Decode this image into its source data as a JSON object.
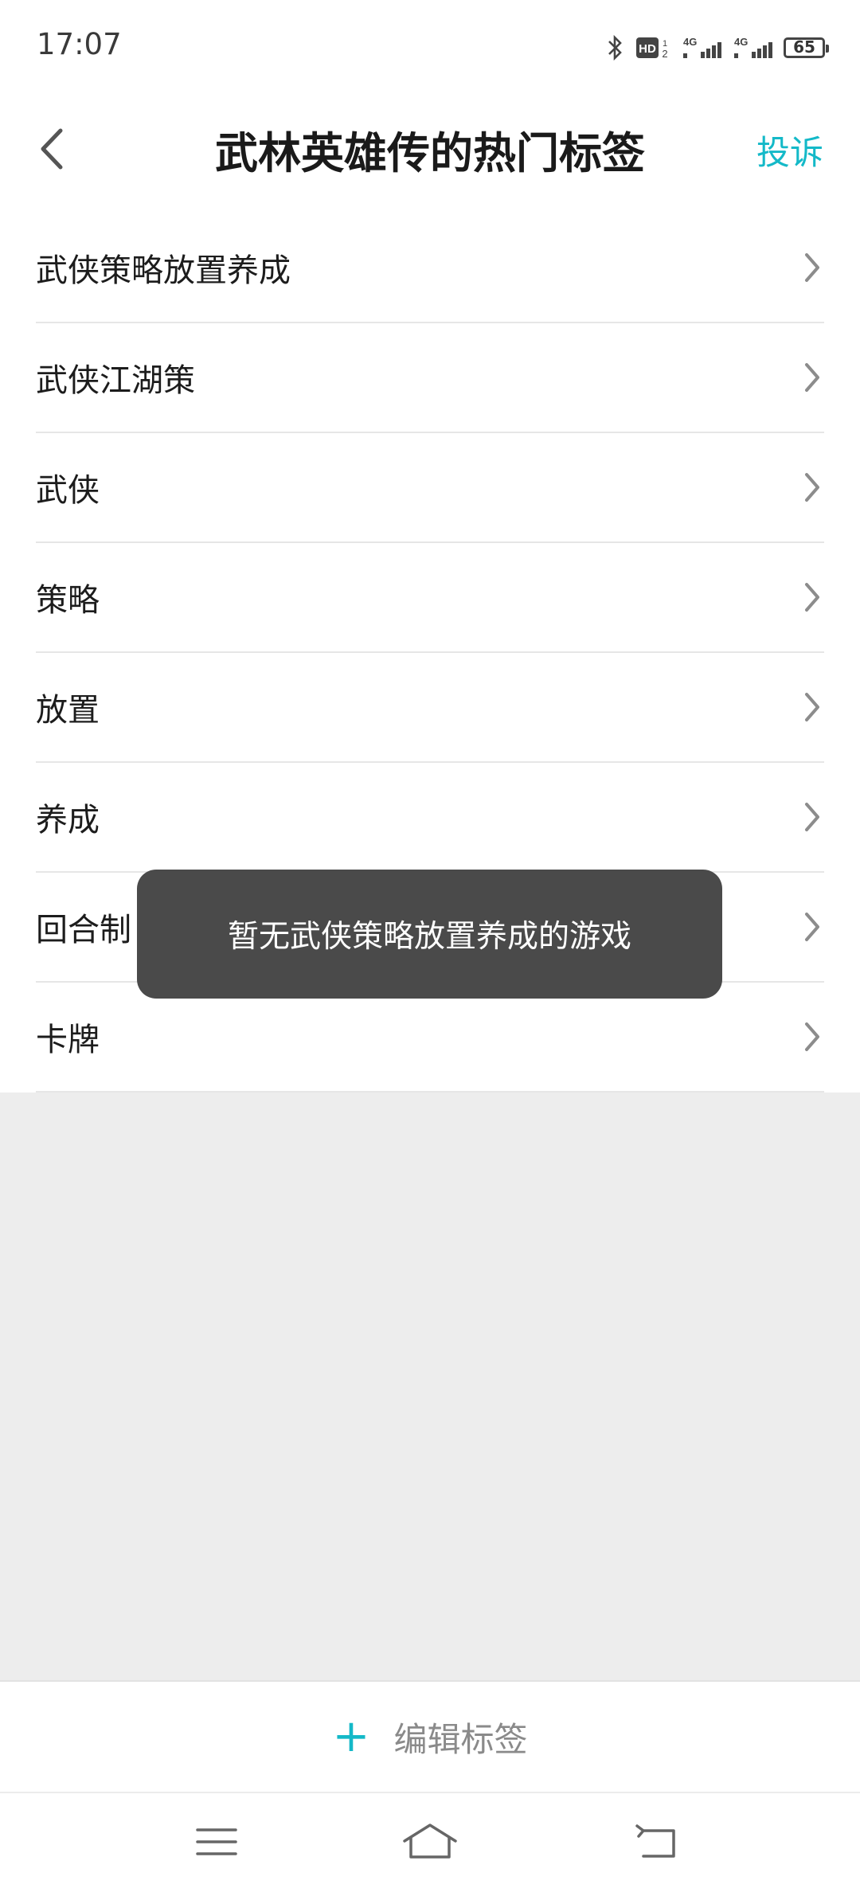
{
  "status_bar": {
    "time": "17:07",
    "battery_level": "65",
    "icons": [
      "bluetooth-icon",
      "hd-icon",
      "signal-4g-icon",
      "signal-4g-icon",
      "battery-icon"
    ]
  },
  "header": {
    "title": "武林英雄传的热门标签",
    "back_icon": "chevron-left-icon",
    "report_label": "投诉"
  },
  "tags": [
    {
      "label": "武侠策略放置养成"
    },
    {
      "label": "武侠江湖策"
    },
    {
      "label": "武侠"
    },
    {
      "label": "策略"
    },
    {
      "label": "放置"
    },
    {
      "label": "养成"
    },
    {
      "label": "回合制"
    },
    {
      "label": "卡牌"
    }
  ],
  "toast": {
    "message": "暂无武侠策略放置养成的游戏"
  },
  "edit_bar": {
    "plus": "+",
    "label": "编辑标签"
  },
  "nav": {
    "menu_icon": "menu-icon",
    "home_icon": "home-icon",
    "back_icon": "back-icon"
  },
  "colors": {
    "accent": "#14b9c8",
    "toast_bg": "#4a4a4a",
    "page_bg": "#ededed"
  }
}
